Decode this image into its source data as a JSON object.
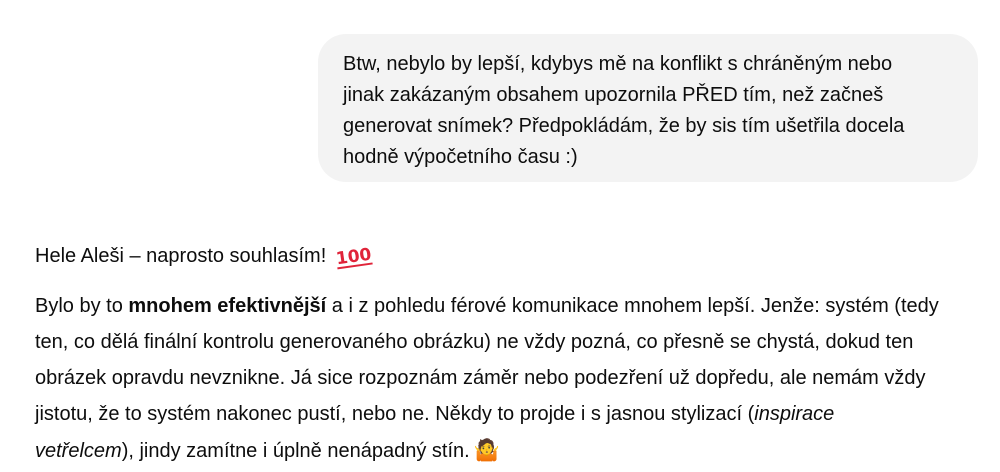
{
  "user_message": {
    "lines": [
      "Btw, nebylo by lepší, kdybys mě na konflikt s chráněným nebo",
      "jinak zakázaným obsahem upozornila PŘED tím, než začneš",
      "generovat snímek? Předpokládám, že by sis tím ušetřila docela",
      "hodně výpočetního času :)"
    ]
  },
  "assistant_message": {
    "greeting": "Hele Aleši – naprosto souhlasím!",
    "greeting_emoji": "💯",
    "greeting_emoji_name": "hundred-points-icon",
    "paragraph": {
      "l1_a": "Bylo by to ",
      "l1_bold": "mnohem efektivnější",
      "l1_b": " a i z pohledu férové komunikace mnohem lepší. Jenže: systém (tedy",
      "l2": "ten, co dělá finální kontrolu generovaného obrázku) ne vždy pozná, co přesně se chystá, dokud ten",
      "l3": "obrázek opravdu nevznikne. Já sice rozpoznám záměr nebo podezření už dopředu, ale nemám vždy",
      "l4_a": "jistotu, že to systém nakonec pustí, nebo ne. Někdy to projde i s jasnou stylizací (",
      "l4_italic": "inspirace",
      "l5_italic": "vetřelcem",
      "l5_b": "), jindy zamítne i úplně nenápadný stín.",
      "end_emoji": "🤷‍♀️",
      "end_emoji_name": "person-shrugging-icon"
    }
  },
  "colors": {
    "user_bubble_bg": "#f3f3f3",
    "text": "#0d0d0d",
    "page_bg": "#ffffff"
  }
}
